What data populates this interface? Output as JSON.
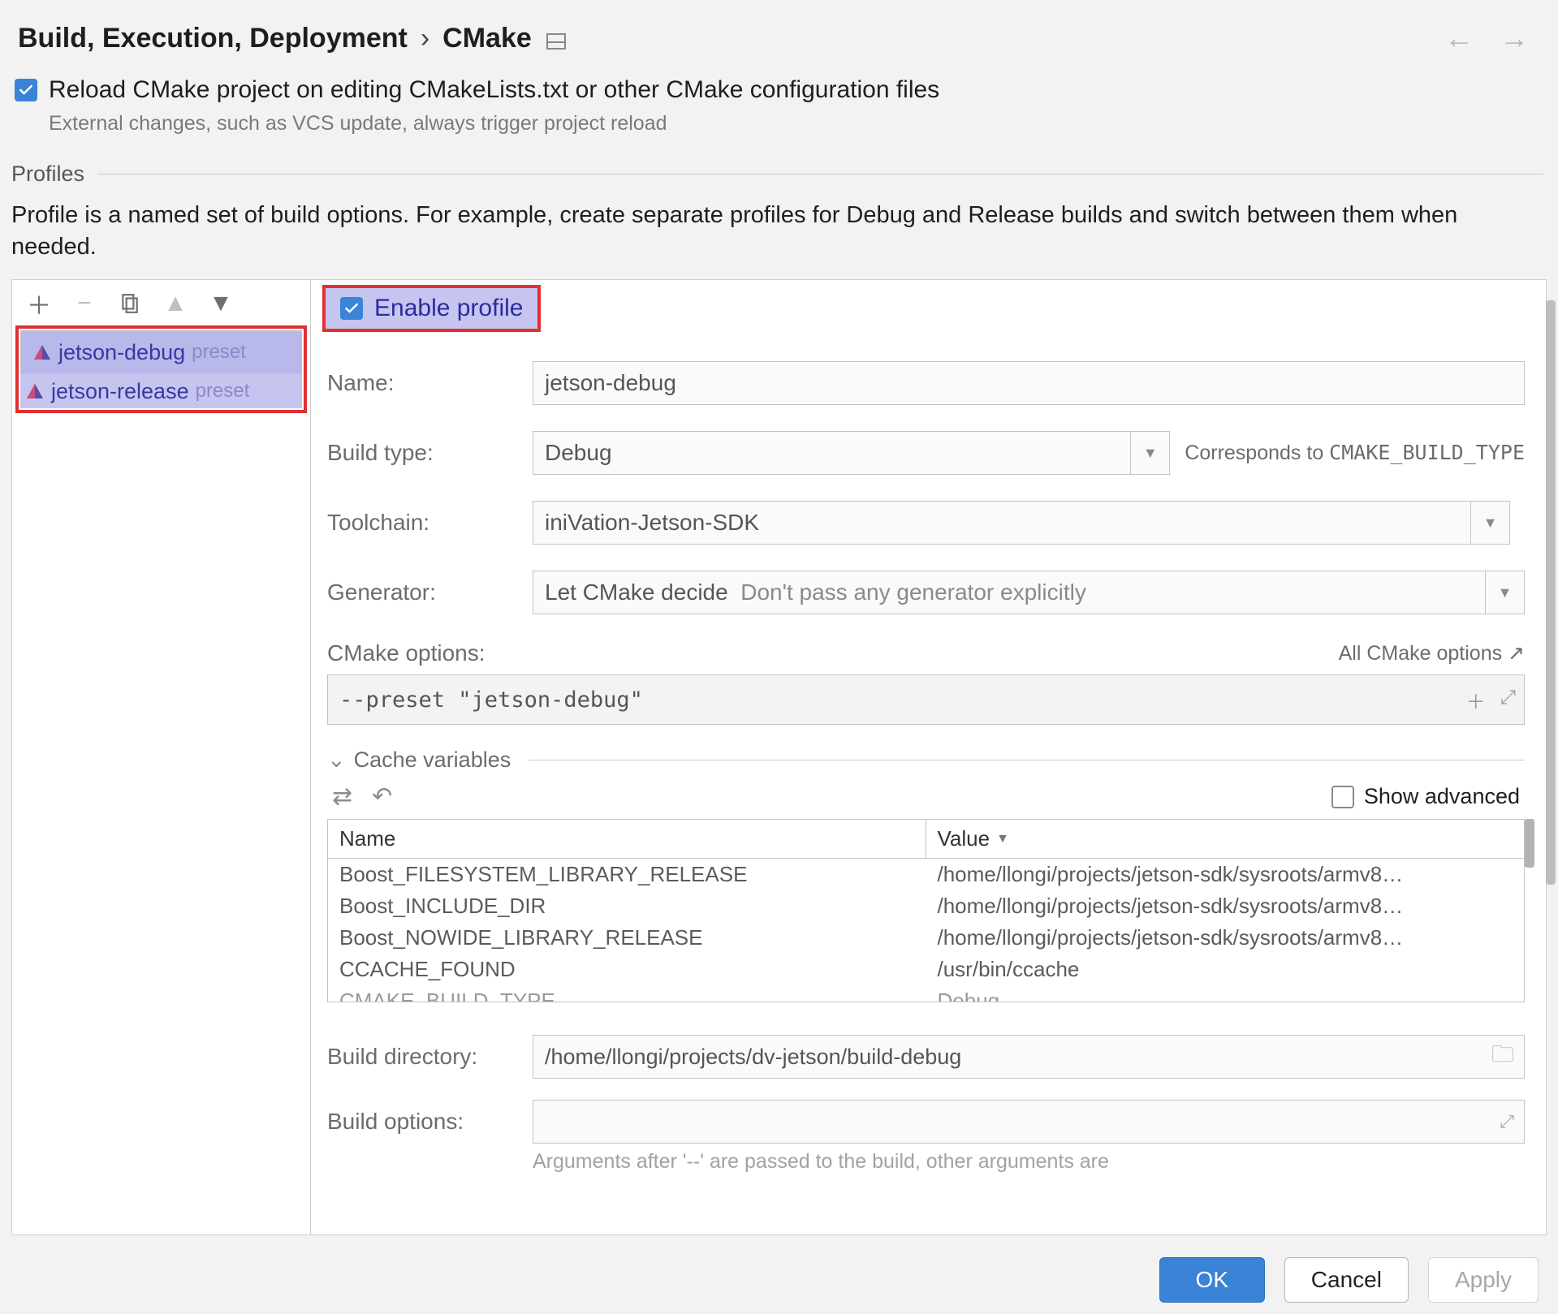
{
  "breadcrumb": {
    "parent": "Build, Execution, Deployment",
    "sep": "›",
    "current": "CMake"
  },
  "reload": {
    "label": "Reload CMake project on editing CMakeLists.txt or other CMake configuration files",
    "hint": "External changes, such as VCS update, always trigger project reload",
    "checked": true
  },
  "profiles_section_title": "Profiles",
  "profiles_desc": "Profile is a named set of build options. For example, create separate profiles for Debug and Release builds and switch between them when needed.",
  "sidebar": {
    "items": [
      {
        "name": "jetson-debug",
        "tag": "preset",
        "selected": true
      },
      {
        "name": "jetson-release",
        "tag": "preset",
        "selected": false
      }
    ]
  },
  "enable_profile": {
    "label": "Enable profile",
    "checked": true
  },
  "form": {
    "name_label": "Name:",
    "name_value": "jetson-debug",
    "build_type_label": "Build type:",
    "build_type_value": "Debug",
    "build_type_hint_prefix": "Corresponds to ",
    "build_type_hint_code": "CMAKE_BUILD_TYPE",
    "toolchain_label": "Toolchain:",
    "toolchain_value": "iniVation-Jetson-SDK",
    "generator_label": "Generator:",
    "generator_value": "Let CMake decide",
    "generator_hint_inline": "Don't pass any generator explicitly",
    "cmake_options_label": "CMake options:",
    "cmake_options_link": "All CMake options ↗",
    "cmake_options_value": "--preset \"jetson-debug\"",
    "build_directory_label": "Build directory:",
    "build_directory_value": "/home/llongi/projects/dv-jetson/build-debug",
    "build_options_label": "Build options:",
    "build_options_note": "Arguments after '--' are passed to the build, other arguments are"
  },
  "cache": {
    "title": "Cache variables",
    "show_advanced_label": "Show advanced",
    "show_advanced_checked": false,
    "columns": {
      "name": "Name",
      "value": "Value"
    },
    "rows": [
      {
        "name": "Boost_FILESYSTEM_LIBRARY_RELEASE",
        "value": "/home/llongi/projects/jetson-sdk/sysroots/armv8…"
      },
      {
        "name": "Boost_INCLUDE_DIR",
        "value": "/home/llongi/projects/jetson-sdk/sysroots/armv8…"
      },
      {
        "name": "Boost_NOWIDE_LIBRARY_RELEASE",
        "value": "/home/llongi/projects/jetson-sdk/sysroots/armv8…"
      },
      {
        "name": "CCACHE_FOUND",
        "value": "/usr/bin/ccache"
      },
      {
        "name": "CMAKE_BUILD_TYPE",
        "value": "Debug"
      }
    ]
  },
  "buttons": {
    "ok": "OK",
    "cancel": "Cancel",
    "apply": "Apply"
  }
}
